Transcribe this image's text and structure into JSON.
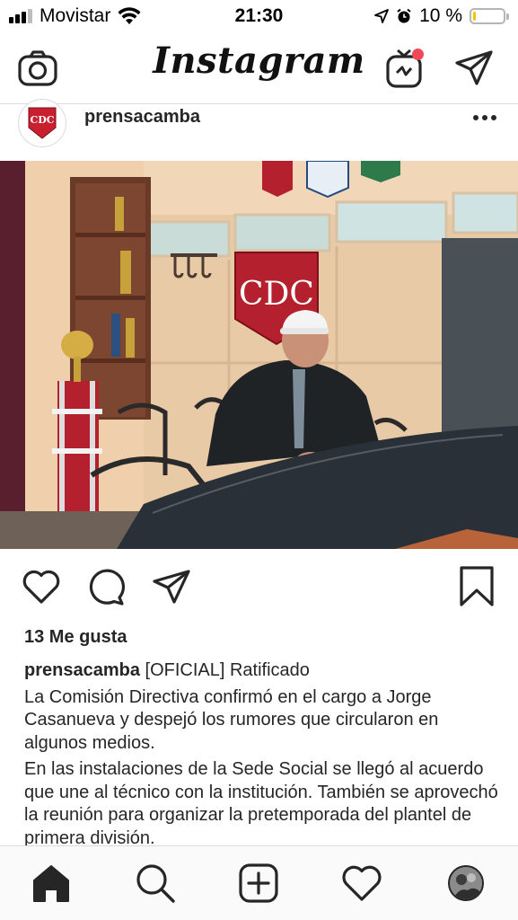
{
  "status_bar": {
    "carrier": "Movistar",
    "time": "21:30",
    "battery_text": "10 %",
    "battery_level": 0.1
  },
  "header": {
    "logo": "Instagram",
    "icons": [
      "camera-icon",
      "igtv-icon",
      "direct-message-icon"
    ],
    "igtv_notification_color": "#ed4956"
  },
  "post": {
    "username": "prensacamba",
    "likes": "13 Me gusta",
    "caption_user": "prensacamba",
    "caption_title": " [OFICIAL] Ratificado",
    "paragraph_1": "La Comisión Directiva confirmó en el cargo a Jorge Casanueva y despejó los rumores que circularon en algunos medios.",
    "paragraph_2": "En las instalaciones de la Sede Social se llegó al acuerdo que une al técnico con la institución. También se aprovechó la reunión para organizar la pretemporada del plantel de primera división.",
    "banner_letters": "CDC"
  },
  "actions": [
    "heart-icon",
    "comment-icon",
    "share-icon",
    "bookmark-icon"
  ],
  "bottom_nav": [
    "home-icon",
    "search-icon",
    "new-post-icon",
    "activity-icon",
    "profile-avatar"
  ],
  "colors": {
    "text": "#262626",
    "divider": "#dbdbdb",
    "club_red": "#b5202e",
    "battery_fill": "#f2c500"
  }
}
